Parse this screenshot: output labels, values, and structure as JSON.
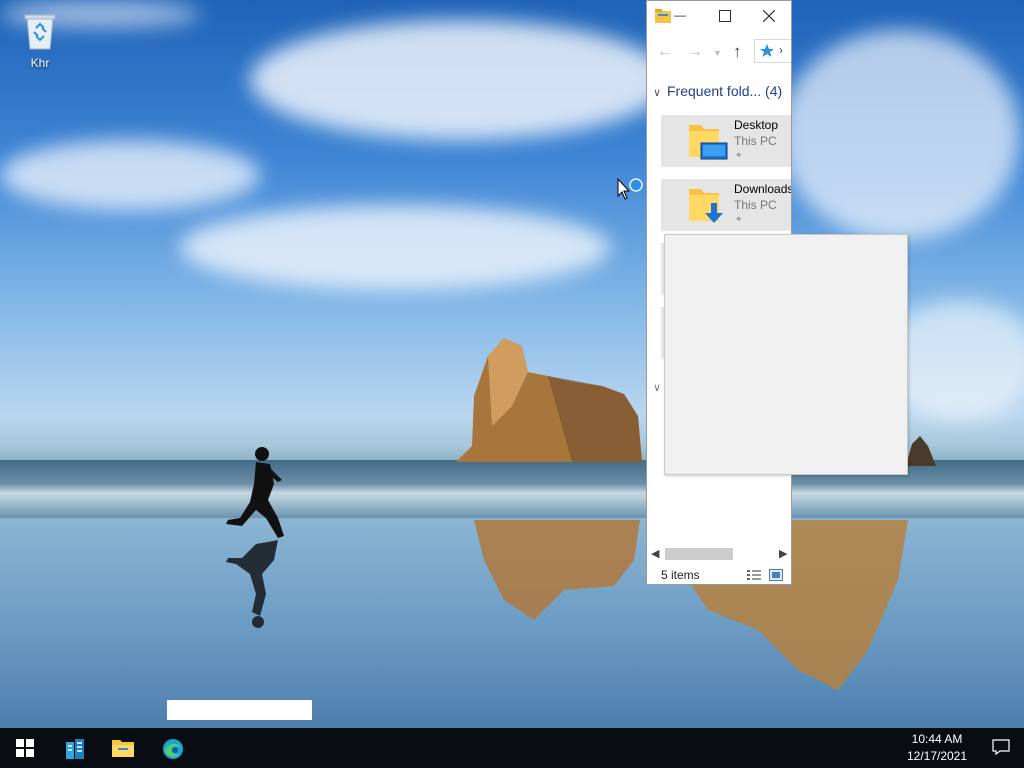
{
  "desktop": {
    "icons": [
      {
        "label": "Khr",
        "icon": "recycle-bin-icon"
      }
    ]
  },
  "explorer": {
    "title_dash": "—",
    "section_header": "Frequent fold... (4)",
    "items": [
      {
        "name": "Desktop",
        "location": "This PC",
        "icon": "desktop-folder-icon"
      },
      {
        "name": "Downloads",
        "location": "This PC",
        "icon": "downloads-folder-icon"
      }
    ],
    "status": "5 items"
  },
  "taskbar": {
    "items": [
      {
        "name": "Start",
        "icon": "windows-start-icon"
      },
      {
        "name": "Server Manager",
        "icon": "server-manager-icon"
      },
      {
        "name": "File Explorer",
        "icon": "file-explorer-icon"
      },
      {
        "name": "Microsoft Edge",
        "icon": "edge-icon"
      }
    ],
    "time": "10:44 AM",
    "date": "12/17/2021"
  },
  "colors": {
    "taskbar": "#080d14",
    "folder_yellow": "#f5c542",
    "accent_blue": "#1e73d8",
    "section_header": "#1e3e8c"
  }
}
